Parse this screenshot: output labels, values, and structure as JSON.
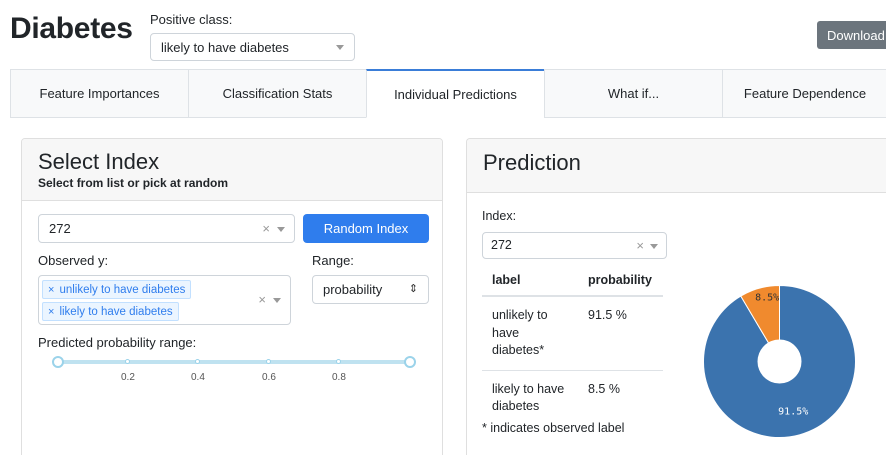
{
  "header": {
    "title": "Diabetes",
    "positive_class_label": "Positive class:",
    "positive_class_value": "likely to have diabetes",
    "download_label": "Download ▾"
  },
  "tabs": [
    {
      "label": "Feature Importances"
    },
    {
      "label": "Classification Stats"
    },
    {
      "label": "Individual Predictions",
      "active": true
    },
    {
      "label": "What if..."
    },
    {
      "label": "Feature Dependence"
    }
  ],
  "select_index": {
    "title": "Select Index",
    "subtitle": "Select from list or pick at random",
    "index_value": "272",
    "clear_symbol": "×",
    "random_button": "Random Index",
    "observed_label": "Observed y:",
    "observed_chips": [
      "unlikely to have diabetes",
      "likely to have diabetes"
    ],
    "chip_remove_symbol": "×",
    "range_label": "Range:",
    "range_value": "probability",
    "range_arrows": "⇕",
    "prob_range_label": "Predicted probability range:",
    "slider": {
      "min": 0,
      "max": 1,
      "ticks": [
        "0.2",
        "0.4",
        "0.6",
        "0.8"
      ]
    }
  },
  "prediction": {
    "title": "Prediction",
    "index_label": "Index:",
    "index_value": "272",
    "clear_symbol": "×",
    "table": {
      "headers": [
        "label",
        "probability"
      ],
      "rows": [
        {
          "label": "unlikely to have diabetes*",
          "prob": "91.5 %"
        },
        {
          "label": "likely to have diabetes",
          "prob": "8.5 %"
        }
      ]
    },
    "footnote": "* indicates observed label"
  },
  "chart_data": {
    "type": "pie",
    "categories": [
      "unlikely to have diabetes",
      "likely to have diabetes"
    ],
    "values": [
      91.5,
      8.5
    ],
    "labels": [
      "91.5%",
      "8.5%"
    ],
    "colors": [
      "#3b73ae",
      "#f08a2e"
    ],
    "donut": true
  }
}
